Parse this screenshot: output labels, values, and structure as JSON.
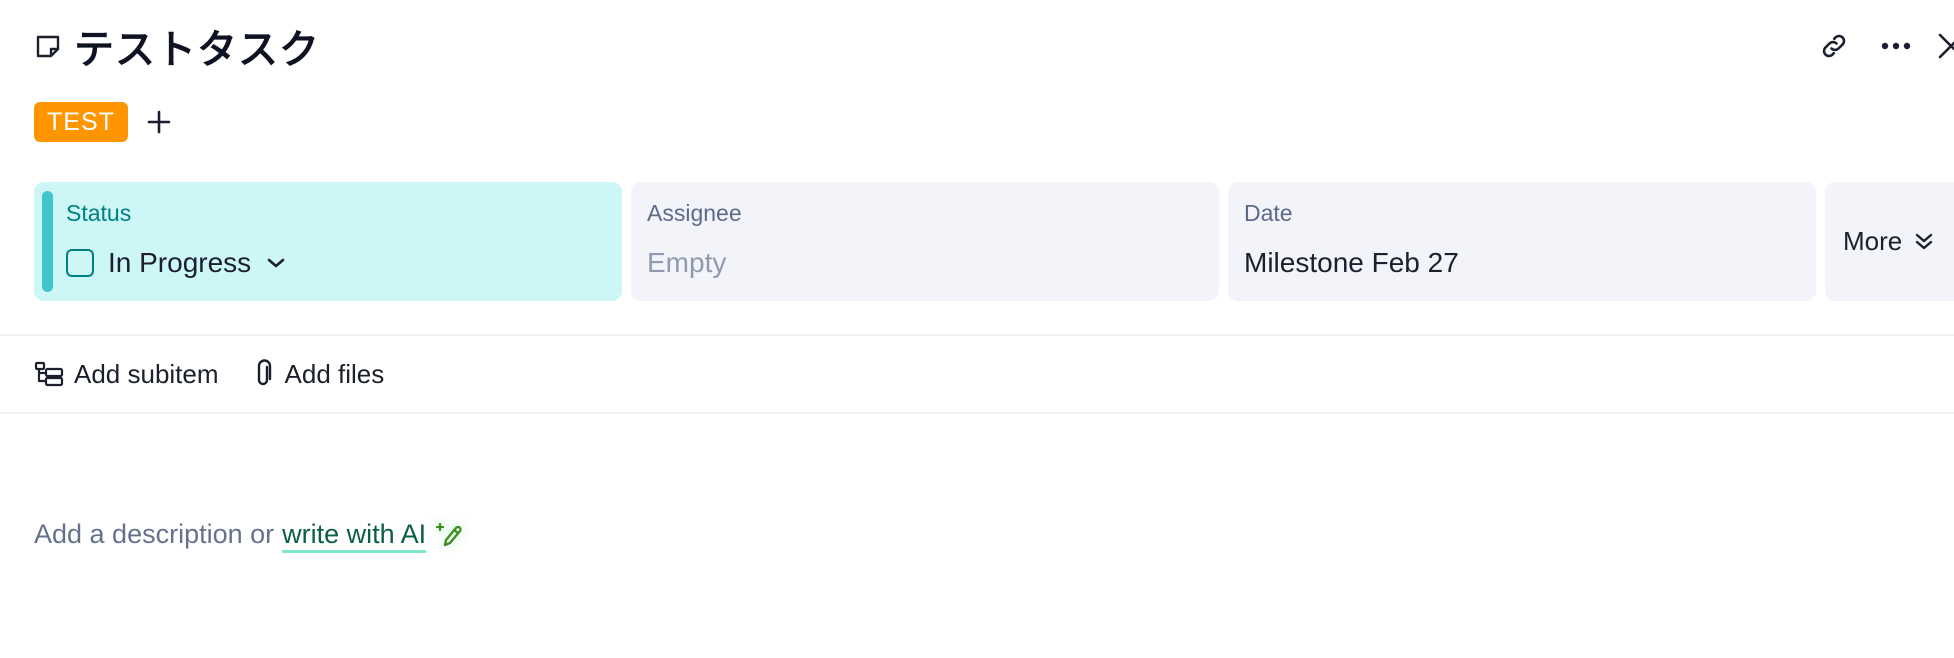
{
  "task": {
    "title": "テストタスク"
  },
  "tags": [
    {
      "label": "TEST",
      "color": "#ff9500"
    }
  ],
  "fields": {
    "status": {
      "label": "Status",
      "value": "In Progress",
      "accent": "#3ec6cc"
    },
    "assignee": {
      "label": "Assignee",
      "value": "Empty"
    },
    "date": {
      "label": "Date",
      "value": "Milestone Feb 27"
    },
    "more": {
      "label": "More"
    }
  },
  "actions": {
    "add_subitem": "Add subitem",
    "add_files": "Add files"
  },
  "description": {
    "placeholder": "Add a description or",
    "ai_link": "write with AI"
  },
  "icons": {
    "title": "note-icon",
    "header": [
      "link-icon",
      "more-horizontal-icon",
      "close-icon"
    ],
    "add_tag": "plus-icon",
    "status_toggle": "chevron-down-icon",
    "more": "double-chevron-down-icon",
    "add_subitem": "subitem-icon",
    "add_files": "paperclip-icon",
    "ai": "magic-pen-icon"
  }
}
